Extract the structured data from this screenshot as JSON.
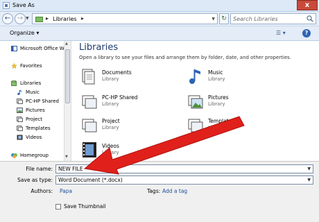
{
  "window": {
    "title": "Save As",
    "close_glyph": "x"
  },
  "address": {
    "separator": "▸",
    "crumb": "Libraries"
  },
  "search": {
    "placeholder": "Search Libraries"
  },
  "toolbar": {
    "organize_label": "Organize ▾",
    "help_glyph": "?"
  },
  "nav": {
    "items": [
      {
        "label": "Microsoft Office W",
        "icon": "word-icon"
      },
      {
        "label": "Favorites",
        "icon": "star-icon"
      },
      {
        "label": "Libraries",
        "icon": "libraries-icon"
      },
      {
        "label": "Music",
        "icon": "music-icon"
      },
      {
        "label": "PC-HP Shared",
        "icon": "shared-library-icon"
      },
      {
        "label": "Pictures",
        "icon": "pictures-icon"
      },
      {
        "label": "Project",
        "icon": "project-library-icon"
      },
      {
        "label": "Templates",
        "icon": "templates-icon"
      },
      {
        "label": "Videos",
        "icon": "videos-icon"
      },
      {
        "label": "Homegroup",
        "icon": "homegroup-icon"
      }
    ]
  },
  "content": {
    "title": "Libraries",
    "subtitle": "Open a library to see your files and arrange them by folder, date, and other properties.",
    "libraries": [
      {
        "name": "Documents",
        "type": "Library",
        "icon": "documents-icon"
      },
      {
        "name": "Music",
        "type": "Library",
        "icon": "music-icon"
      },
      {
        "name": "PC-HP Shared",
        "type": "Library",
        "icon": "shared-library-icon"
      },
      {
        "name": "Pictures",
        "type": "Library",
        "icon": "pictures-icon"
      },
      {
        "name": "Project",
        "type": "Library",
        "icon": "project-library-icon"
      },
      {
        "name": "Templates",
        "type": "Library",
        "icon": "templates-icon"
      },
      {
        "name": "Videos",
        "type": "Library",
        "icon": "videos-icon"
      }
    ]
  },
  "form": {
    "file_name_label": "File name:",
    "file_name_value": "NEW FILE",
    "save_type_label": "Save as type:",
    "save_type_value": "Word Document (*.docx)",
    "authors_label": "Authors:",
    "authors_value": "Papa",
    "tags_label": "Tags:",
    "tags_value": "Add a tag",
    "thumbnail_label": "Save Thumbnail",
    "thumbnail_checked": false
  },
  "colors": {
    "annotation_arrow": "#e0201b",
    "link": "#1f4e99",
    "title_text": "#1e3a6e"
  }
}
